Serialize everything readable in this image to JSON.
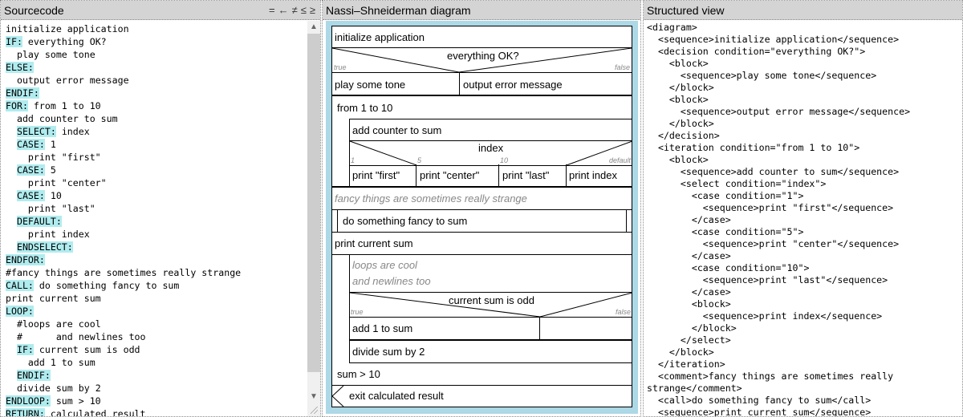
{
  "source_pane": {
    "title": "Sourcecode",
    "operators": [
      "=",
      "←",
      "≠",
      "≤",
      "≥"
    ],
    "lines": [
      {
        "indent": "",
        "kw": "",
        "text": "initialize application"
      },
      {
        "indent": "",
        "kw": "IF:",
        "text": " everything OK?"
      },
      {
        "indent": "  ",
        "kw": "",
        "text": "play some tone"
      },
      {
        "indent": "",
        "kw": "ELSE:",
        "text": ""
      },
      {
        "indent": "  ",
        "kw": "",
        "text": "output error message"
      },
      {
        "indent": "",
        "kw": "ENDIF:",
        "text": ""
      },
      {
        "indent": "",
        "kw": "FOR:",
        "text": " from 1 to 10"
      },
      {
        "indent": "  ",
        "kw": "",
        "text": "add counter to sum"
      },
      {
        "indent": "  ",
        "kw": "SELECT:",
        "text": " index"
      },
      {
        "indent": "  ",
        "kw": "CASE:",
        "text": " 1"
      },
      {
        "indent": "    ",
        "kw": "",
        "text": "print \"first\""
      },
      {
        "indent": "  ",
        "kw": "CASE:",
        "text": " 5"
      },
      {
        "indent": "    ",
        "kw": "",
        "text": "print \"center\""
      },
      {
        "indent": "  ",
        "kw": "CASE:",
        "text": " 10"
      },
      {
        "indent": "    ",
        "kw": "",
        "text": "print \"last\""
      },
      {
        "indent": "  ",
        "kw": "DEFAULT:",
        "text": ""
      },
      {
        "indent": "    ",
        "kw": "",
        "text": "print index"
      },
      {
        "indent": "  ",
        "kw": "ENDSELECT:",
        "text": ""
      },
      {
        "indent": "",
        "kw": "ENDFOR:",
        "text": ""
      },
      {
        "indent": "",
        "kw": "",
        "text": "#fancy things are sometimes really strange"
      },
      {
        "indent": "",
        "kw": "CALL:",
        "text": " do something fancy to sum"
      },
      {
        "indent": "",
        "kw": "",
        "text": "print current sum"
      },
      {
        "indent": "",
        "kw": "LOOP:",
        "text": ""
      },
      {
        "indent": "  ",
        "kw": "",
        "text": "#loops are cool"
      },
      {
        "indent": "  ",
        "kw": "",
        "text": "#      and newlines too"
      },
      {
        "indent": "  ",
        "kw": "IF:",
        "text": " current sum is odd"
      },
      {
        "indent": "    ",
        "kw": "",
        "text": "add 1 to sum"
      },
      {
        "indent": "  ",
        "kw": "ENDIF:",
        "text": ""
      },
      {
        "indent": "  ",
        "kw": "",
        "text": "divide sum by 2"
      },
      {
        "indent": "",
        "kw": "ENDLOOP:",
        "text": " sum > 10"
      },
      {
        "indent": "",
        "kw": "RETURN:",
        "text": " calculated result"
      }
    ]
  },
  "nsd_pane": {
    "title": "Nassi–Shneiderman diagram",
    "init": "initialize application",
    "decision1": {
      "condition": "everything OK?",
      "true_label": "true",
      "false_label": "false",
      "true_branch": "play some tone",
      "false_branch": "output error message"
    },
    "for_loop": {
      "condition": "from 1 to 10",
      "body_first": "add counter to sum"
    },
    "select": {
      "condition": "index",
      "cases": [
        {
          "label": "1",
          "body": "print \"first\""
        },
        {
          "label": "5",
          "body": "print \"center\""
        },
        {
          "label": "10",
          "body": "print \"last\""
        },
        {
          "label": "default",
          "body": "print index"
        }
      ]
    },
    "comment1": "fancy things are sometimes really strange",
    "call": "do something fancy to sum",
    "print_sum": "print current sum",
    "loop": {
      "comment_line1": "loops are cool",
      "comment_line2": "and newlines too",
      "decision": {
        "condition": "current sum is odd",
        "true_label": "true",
        "false_label": "false",
        "true_branch": "add 1 to sum",
        "false_branch": ""
      },
      "divide": "divide sum by 2",
      "until": "sum > 10"
    },
    "return": "exit calculated result"
  },
  "struct_pane": {
    "title": "Structured view",
    "lines": [
      "<diagram>",
      "  <sequence>initialize application</sequence>",
      "  <decision condition=\"everything OK?\">",
      "    <block>",
      "      <sequence>play some tone</sequence>",
      "    </block>",
      "    <block>",
      "      <sequence>output error message</sequence>",
      "    </block>",
      "  </decision>",
      "  <iteration condition=\"from 1 to 10\">",
      "    <block>",
      "      <sequence>add counter to sum</sequence>",
      "      <select condition=\"index\">",
      "        <case condition=\"1\">",
      "          <sequence>print \"first\"</sequence>",
      "        </case>",
      "        <case condition=\"5\">",
      "          <sequence>print \"center\"</sequence>",
      "        </case>",
      "        <case condition=\"10\">",
      "          <sequence>print \"last\"</sequence>",
      "        </case>",
      "        <block>",
      "          <sequence>print index</sequence>",
      "        </block>",
      "      </select>",
      "    </block>",
      "  </iteration>",
      "  <comment>fancy things are sometimes really",
      "strange</comment>",
      "  <call>do something fancy to sum</call>",
      "  <sequence>print current sum</sequence>"
    ]
  },
  "colors": {
    "keyword_highlight": "#b0ecef",
    "diagram_background": "#add8e6",
    "header_background": "#d4d4d4",
    "comment_text": "#888888"
  }
}
